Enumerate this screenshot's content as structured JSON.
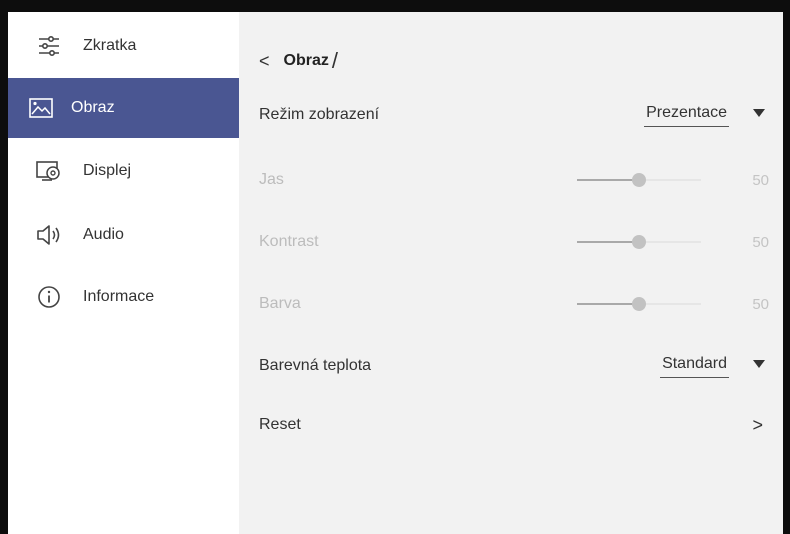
{
  "sidebar": {
    "items": [
      {
        "label": "Zkratka",
        "icon": "sliders-icon"
      },
      {
        "label": "Obraz",
        "icon": "image-icon",
        "active": true
      },
      {
        "label": "Displej",
        "icon": "display-settings-icon"
      },
      {
        "label": "Audio",
        "icon": "speaker-icon"
      },
      {
        "label": "Informace",
        "icon": "info-icon"
      }
    ]
  },
  "header": {
    "back_symbol": "<",
    "title": "Obraz",
    "separator": "/"
  },
  "settings": {
    "display_mode": {
      "label": "Režim zobrazení",
      "value": "Prezentace"
    },
    "brightness": {
      "label": "Jas",
      "value": "50",
      "level": 0.5
    },
    "contrast": {
      "label": "Kontrast",
      "value": "50",
      "level": 0.5
    },
    "color": {
      "label": "Barva",
      "value": "50",
      "level": 0.5
    },
    "color_temp": {
      "label": "Barevná teplota",
      "value": "Standard"
    },
    "reset": {
      "label": "Reset",
      "chevron": ">"
    }
  },
  "colors": {
    "accent": "#4a5692",
    "panel": "#f2f2f2",
    "disabled_text": "#bcbcbc"
  }
}
